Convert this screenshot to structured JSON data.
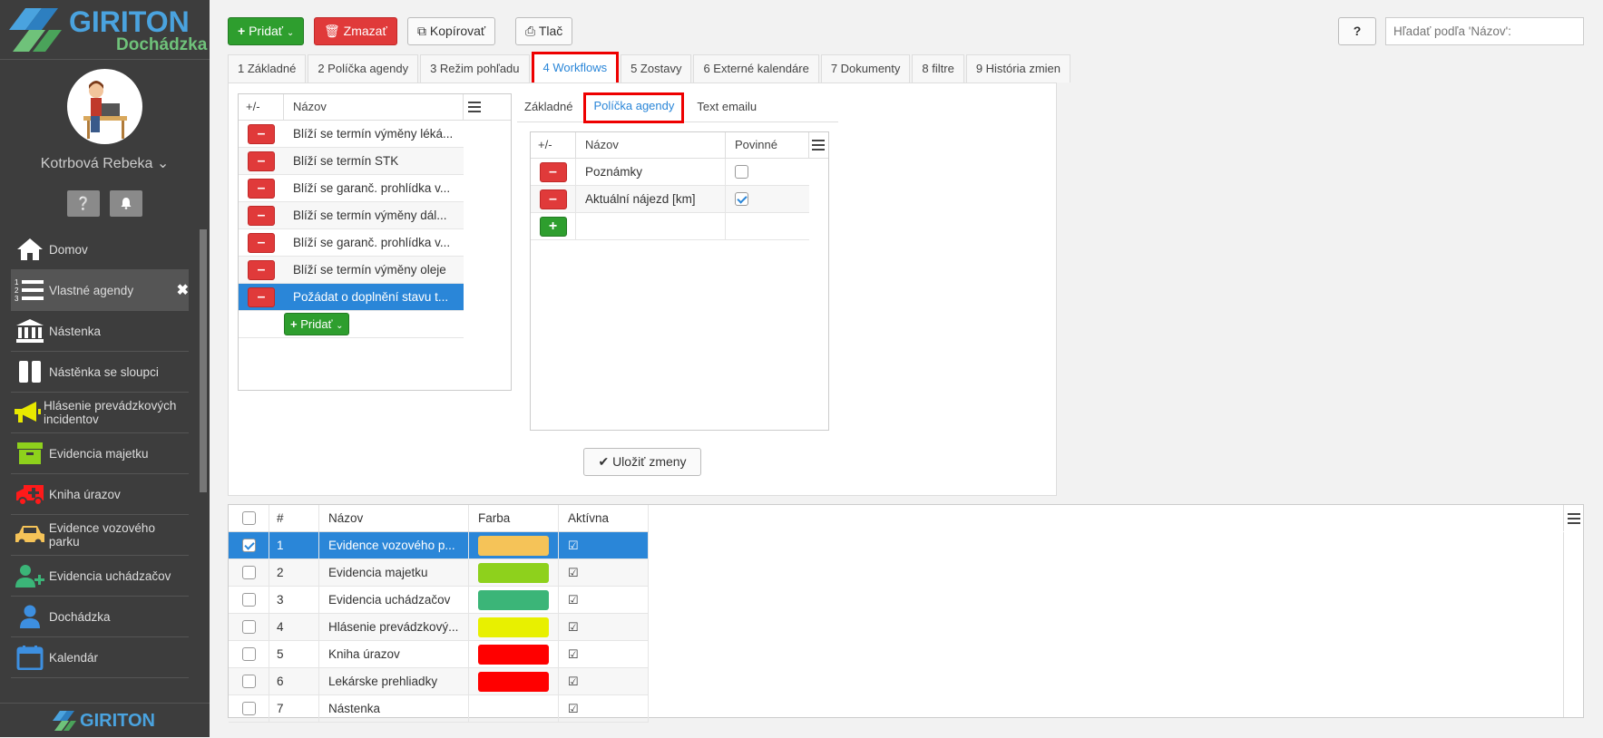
{
  "app": {
    "brand": "GIRITON",
    "subtitle": "Dochádzka",
    "footer_brand": "GIRITON"
  },
  "user": {
    "name": "Kotrbová Rebeka ⌄"
  },
  "sidebar": {
    "help_icon": "question-icon",
    "bell_icon": "bell-icon",
    "items": [
      {
        "label": "Domov",
        "icon": "home-icon",
        "color": "#ffffff"
      },
      {
        "label": "Vlastné agendy",
        "icon": "list-numbered-icon",
        "color": "#ffffff",
        "active": true
      },
      {
        "label": "Nástenka",
        "icon": "bank-icon",
        "color": "#ffffff"
      },
      {
        "label": "Nástěnka se sloupci",
        "icon": "columns-icon",
        "color": "#ffffff"
      },
      {
        "label": "Hlásenie prevádzkových incidentov",
        "icon": "megaphone-icon",
        "color": "#e8e800"
      },
      {
        "label": "Evidencia majetku",
        "icon": "archive-icon",
        "color": "#8ed11c"
      },
      {
        "label": "Kniha úrazov",
        "icon": "ambulance-icon",
        "color": "#ff1a1a"
      },
      {
        "label": "Evidence vozového parku",
        "icon": "car-icon",
        "color": "#f5c358"
      },
      {
        "label": "Evidencia uchádzačov",
        "icon": "user-plus-icon",
        "color": "#3bb578"
      },
      {
        "label": "Dochádzka",
        "icon": "user-icon",
        "color": "#3d8fe0"
      },
      {
        "label": "Kalendár",
        "icon": "calendar-icon",
        "color": "#3d8fe0"
      }
    ]
  },
  "toolbar": {
    "add": "Pridať",
    "delete": "Zmazať",
    "copy": "Kopírovať",
    "print": "Tlač",
    "help": "?"
  },
  "search": {
    "placeholder": "Hľadať podľa 'Názov':"
  },
  "tabs": [
    "1 Základné",
    "2 Políčka agendy",
    "3 Režim pohľadu",
    "4 Workflows",
    "5 Zostavy",
    "6 Externé kalendáre",
    "7 Dokumenty",
    "8 filtre",
    "9 História zmien"
  ],
  "workflows": {
    "col_pm": "+/-",
    "col_name": "Názov",
    "rows": [
      "Blíží se termín výměny léká...",
      "Blíží se termín STK",
      "Blíží se garanč. prohlídka v...",
      "Blíží se termín výměny dál...",
      "Blíží se garanč. prohlídka v...",
      "Blíží se termín výměny oleje",
      "Požádat o doplnění stavu t..."
    ],
    "add": "Pridať"
  },
  "subtabs": [
    "Základné",
    "Políčka agendy",
    "Text emailu"
  ],
  "fields": {
    "col_pm": "+/-",
    "col_name": "Názov",
    "col_req": "Povinné",
    "rows": [
      {
        "name": "Poznámky",
        "required": false
      },
      {
        "name": "Aktuální nájezd [km]",
        "required": true
      }
    ]
  },
  "save": "Uložiť zmeny",
  "agendas": {
    "col_num": "#",
    "col_name": "Názov",
    "col_color": "Farba",
    "col_active": "Aktívna",
    "rows": [
      {
        "num": "1",
        "name": "Evidence vozového p...",
        "color": "#f5c358",
        "checked": true
      },
      {
        "num": "2",
        "name": "Evidencia majetku",
        "color": "#8ed11c",
        "checked": false
      },
      {
        "num": "3",
        "name": "Evidencia uchádzačov",
        "color": "#3bb578",
        "checked": false
      },
      {
        "num": "4",
        "name": "Hlásenie prevádzkový...",
        "color": "#e8f000",
        "checked": false
      },
      {
        "num": "5",
        "name": "Kniha úrazov",
        "color": "#ff0000",
        "checked": false
      },
      {
        "num": "6",
        "name": "Lekárske prehliadky",
        "color": "#ff0000",
        "checked": false
      },
      {
        "num": "7",
        "name": "Nástenka",
        "color": "",
        "checked": false
      }
    ]
  }
}
